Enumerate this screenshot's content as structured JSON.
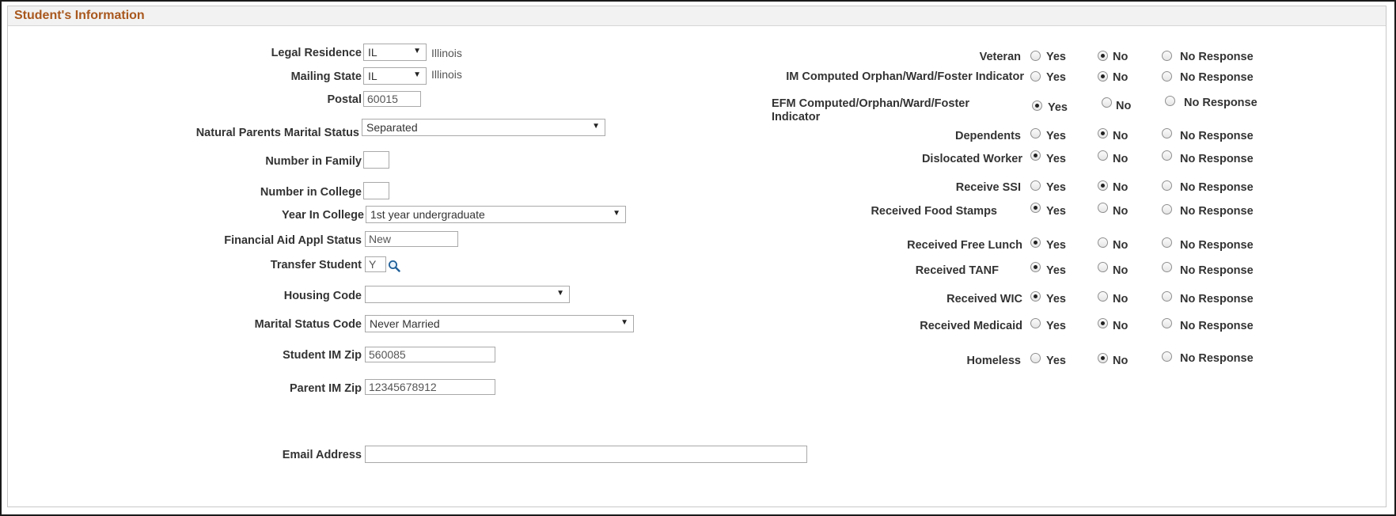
{
  "panel_title": "Student's Information",
  "left": {
    "legal_residence": {
      "label": "Legal Residence",
      "value": "IL",
      "desc": "Illinois"
    },
    "mailing_state": {
      "label": "Mailing State",
      "value": "IL",
      "desc": "Illinois"
    },
    "postal": {
      "label": "Postal",
      "value": "60015"
    },
    "parents_marital": {
      "label": "Natural Parents Marital Status",
      "value": "Separated"
    },
    "number_in_family": {
      "label": "Number in Family",
      "value": ""
    },
    "number_in_college": {
      "label": "Number in College",
      "value": ""
    },
    "year_in_college": {
      "label": "Year In College",
      "value": "1st year undergraduate"
    },
    "fin_aid_status": {
      "label": "Financial Aid Appl Status",
      "value": "New"
    },
    "transfer_student": {
      "label": "Transfer Student",
      "value": "Y"
    },
    "housing_code": {
      "label": "Housing Code",
      "value": ""
    },
    "marital_status_code": {
      "label": "Marital Status Code",
      "value": "Never Married"
    },
    "student_im_zip": {
      "label": "Student IM Zip",
      "value": "560085"
    },
    "parent_im_zip": {
      "label": "Parent IM Zip",
      "value": "12345678912"
    },
    "email": {
      "label": "Email Address",
      "value": ""
    }
  },
  "options": {
    "yes": "Yes",
    "no": "No",
    "no_response": "No Response"
  },
  "right": [
    {
      "label": "Veteran",
      "selected": "no"
    },
    {
      "label": "IM Computed Orphan/Ward/Foster Indicator",
      "selected": "no"
    },
    {
      "label_line1": "EFM Computed/Orphan/Ward/Foster",
      "label_line2": "Indicator",
      "selected": "yes"
    },
    {
      "label": "Dependents",
      "selected": "no"
    },
    {
      "label": "Dislocated Worker",
      "selected": "yes"
    },
    {
      "label": "Receive SSI",
      "selected": "no"
    },
    {
      "label": "Received Food Stamps",
      "selected": "yes"
    },
    {
      "label": "Received Free Lunch",
      "selected": "yes"
    },
    {
      "label": "Received TANF",
      "selected": "yes"
    },
    {
      "label": "Received WIC",
      "selected": "yes"
    },
    {
      "label": "Received Medicaid",
      "selected": "no"
    },
    {
      "label": "Homeless",
      "selected": "no"
    }
  ]
}
